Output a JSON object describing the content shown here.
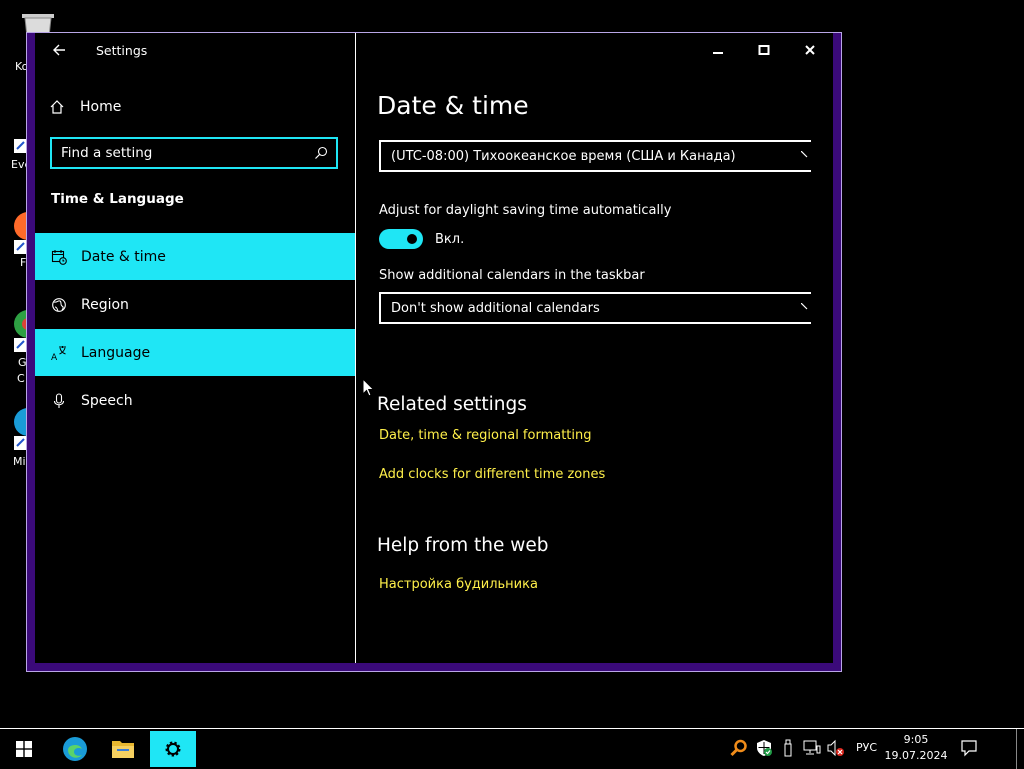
{
  "desktop": {
    "icon_labels": [
      "Ko",
      "Eve",
      "F",
      "G",
      "C",
      "Mi"
    ]
  },
  "window": {
    "title": "Settings",
    "home_label": "Home",
    "search": {
      "placeholder": "Find a setting"
    },
    "section_title": "Time & Language",
    "nav": [
      {
        "label": "Date & time",
        "icon": "calendar-clock-icon",
        "highlighted": true
      },
      {
        "label": "Region",
        "icon": "globe-icon",
        "highlighted": false
      },
      {
        "label": "Language",
        "icon": "language-icon",
        "highlighted": true
      },
      {
        "label": "Speech",
        "icon": "microphone-icon",
        "highlighted": false
      }
    ]
  },
  "content": {
    "page_title": "Date & time",
    "timezone_value": "(UTC-08:00) Тихоокеанское время (США и Канада)",
    "dst_label": "Adjust for daylight saving time automatically",
    "dst_toggle_state": "Вкл.",
    "dst_toggle_on": true,
    "calendars_label": "Show additional calendars in the taskbar",
    "calendars_value": "Don't show additional calendars",
    "related_title": "Related settings",
    "related_links": [
      "Date, time & regional formatting",
      "Add clocks for different time zones"
    ],
    "help_title": "Help from the web",
    "help_links": [
      "Настройка будильника"
    ]
  },
  "taskbar": {
    "pinned": [
      "start-icon",
      "edge-icon",
      "file-explorer-icon",
      "settings-icon"
    ],
    "tray_lang": "РУС",
    "time": "9:05",
    "date": "19.07.2024"
  },
  "colors": {
    "accent": "#1fe6f5",
    "link": "#fff04a",
    "window_frame": "#3b0a7a",
    "background": "#000000"
  }
}
